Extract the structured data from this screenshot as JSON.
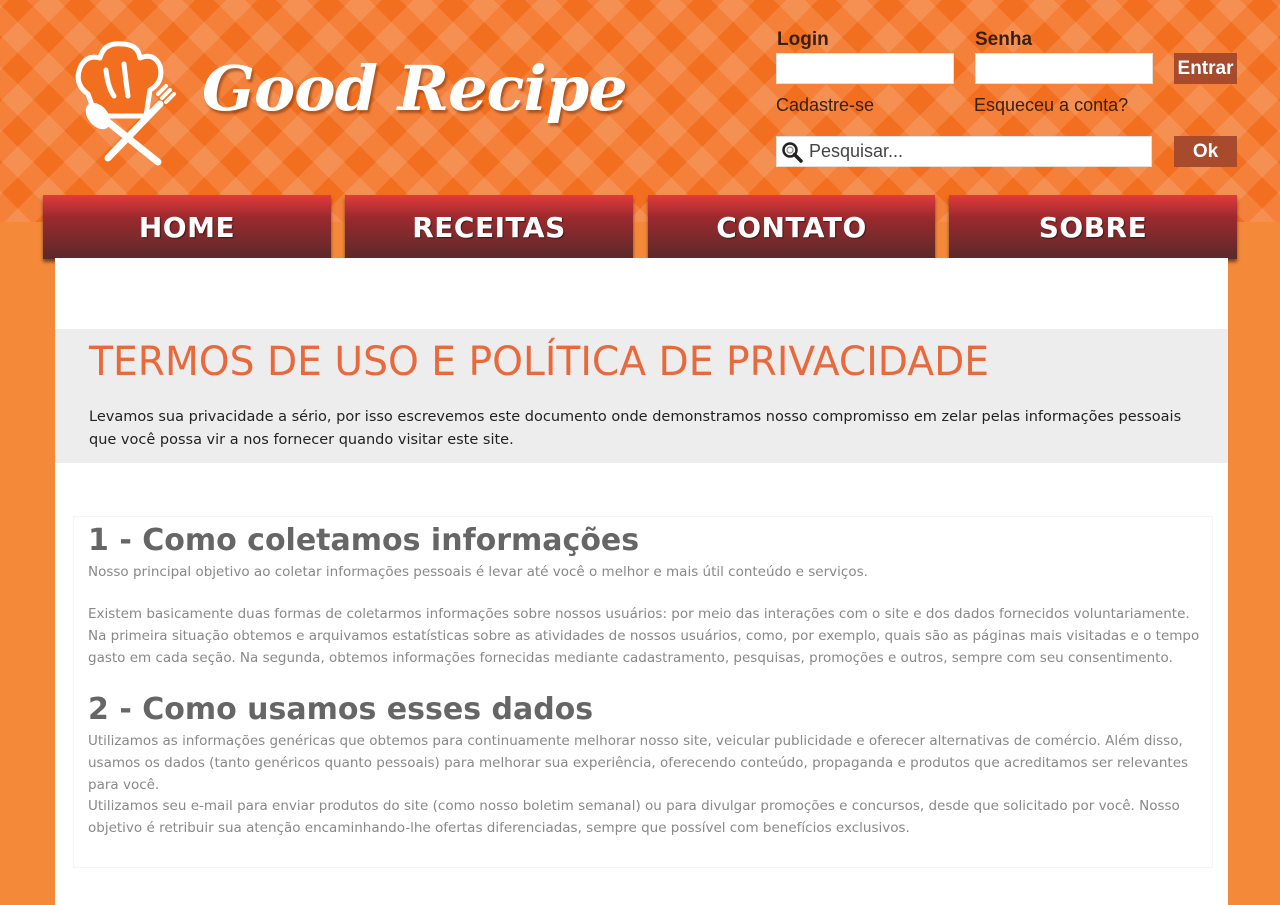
{
  "brand": {
    "name": "Good Recipe"
  },
  "login": {
    "login_label": "Login",
    "password_label": "Senha",
    "login_value": "",
    "password_value": "",
    "submit_label": "Entrar",
    "register_link": "Cadastre-se",
    "forgot_link": "Esqueceu a conta?"
  },
  "search": {
    "placeholder": "Pesquisar...",
    "submit_label": "Ok"
  },
  "nav": {
    "items": [
      {
        "label": "HOME"
      },
      {
        "label": "RECEITAS"
      },
      {
        "label": "CONTATO"
      },
      {
        "label": "SOBRE"
      }
    ]
  },
  "page": {
    "title": "TERMOS DE USO E POLÍTICA DE PRIVACIDADE",
    "intro": "Levamos sua privacidade a sério, por isso escrevemos este documento onde demonstramos nosso compromisso em zelar pelas informações pessoais que você possa vir a nos fornecer quando visitar este site."
  },
  "sections": [
    {
      "title": "1 - Como coletamos informações",
      "paragraphs": [
        "Nosso principal objetivo ao coletar informações pessoais é levar até você o melhor e mais útil conteúdo e serviços.",
        "Existem basicamente duas formas de coletarmos informações sobre nossos usuários: por meio das interações com o site e dos dados fornecidos voluntariamente. Na primeira situação obtemos e arquivamos estatísticas sobre as atividades de nossos usuários, como, por exemplo, quais são as páginas mais visitadas e o tempo gasto em cada seção. Na segunda, obtemos informações fornecidas mediante cadastramento, pesquisas, promoções e outros, sempre com seu consentimento."
      ]
    },
    {
      "title": "2 - Como usamos esses dados",
      "paragraphs": [
        "Utilizamos as informações genéricas que obtemos para continuamente melhorar nosso site, veicular publicidade e oferecer alternativas de comércio. Além disso, usamos os dados (tanto genéricos quanto pessoais) para melhorar sua experiência, oferecendo conteúdo, propaganda e produtos que acreditamos ser relevantes para você.",
        "Utilizamos seu e-mail para enviar produtos do site (como nosso boletim semanal) ou para divulgar promoções e concursos, desde que solicitado por você. Nosso objetivo é retribuir sua atenção encaminhando-lhe ofertas diferenciadas, sempre que possível com benefícios exclusivos."
      ]
    }
  ],
  "icons": {
    "logo": "chef-hat-utensils-icon",
    "search": "search-magnifier-icon"
  },
  "colors": {
    "header": "#f26f1f",
    "background": "#f4893a",
    "button": "#a84a2c",
    "nav_top": "#e23a3a",
    "nav_bottom": "#5a2a2a",
    "title": "#e86a3c"
  }
}
